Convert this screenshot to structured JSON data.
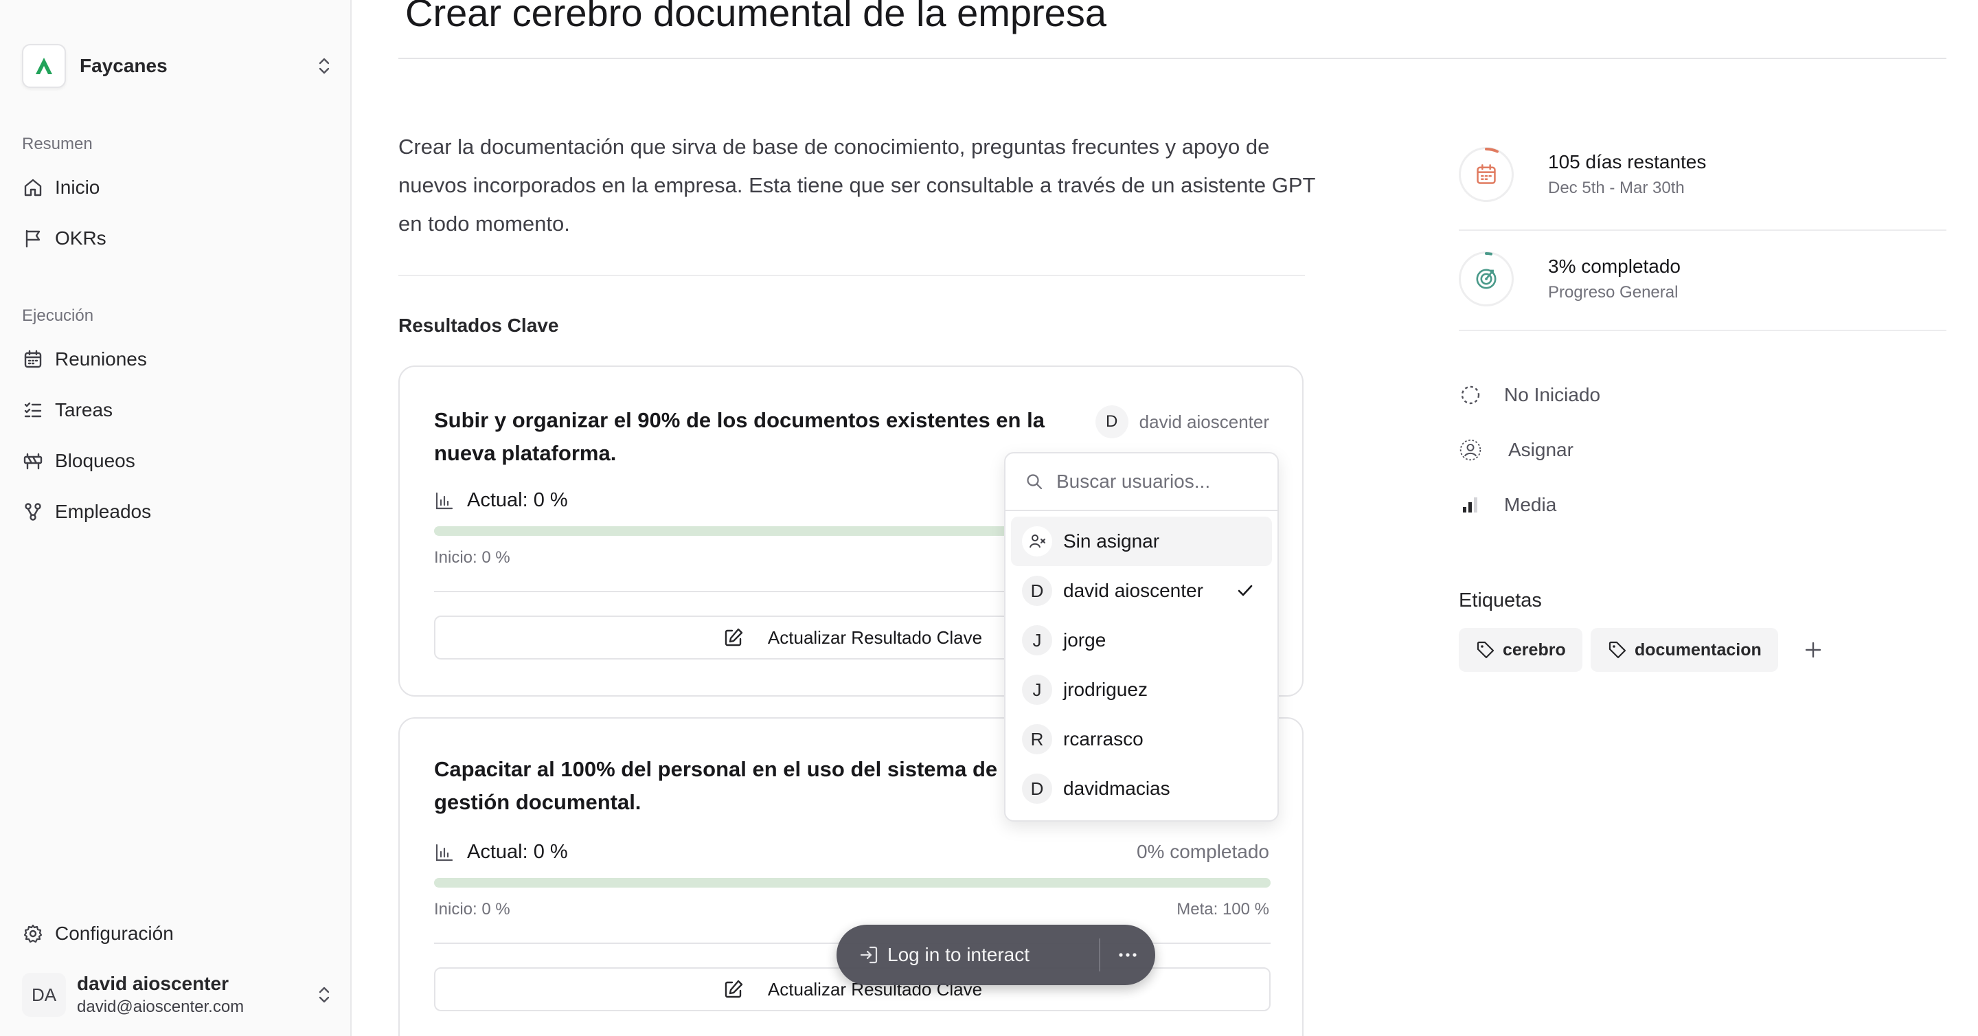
{
  "sidebar": {
    "org_name": "Faycanes",
    "sections": [
      {
        "label": "Resumen"
      },
      {
        "label": "Ejecución"
      }
    ],
    "items": [
      {
        "label": "Inicio",
        "icon": "home-icon"
      },
      {
        "label": "OKRs",
        "icon": "flag-icon"
      },
      {
        "label": "Reuniones",
        "icon": "calendar-icon"
      },
      {
        "label": "Tareas",
        "icon": "list-check-icon"
      },
      {
        "label": "Bloqueos",
        "icon": "roadblock-icon"
      },
      {
        "label": "Empleados",
        "icon": "org-chart-icon"
      }
    ],
    "settings_label": "Configuración",
    "user": {
      "initials": "DA",
      "name": "david aioscenter",
      "email": "david@aioscenter.com"
    }
  },
  "main": {
    "title": "Crear cerebro documental de la empresa",
    "description": "Crear la documentación que sirva de base de conocimiento, preguntas frecuntes y apoyo de nuevos incorporados en la empresa. Esta tiene que ser consultable a través de un asistente GPT en todo momento.",
    "key_results_heading": "Resultados Clave",
    "key_results": [
      {
        "title": "Subir y organizar el 90% de los documentos existentes en la nueva plataforma.",
        "assignee_initial": "D",
        "assignee": "david aioscenter",
        "actual": "Actual: 0 %",
        "progress": 0.0,
        "start": "Inicio: 0 %",
        "update_label": "Actualizar Resultado Clave"
      },
      {
        "title": "Capacitar al 100% del personal en el uso del sistema de gestión documental.",
        "actual": "Actual: 0 %",
        "completed": "0% completado",
        "progress": 0.0,
        "start": "Inicio: 0 %",
        "goal": "Meta: 100 %",
        "update_label": "Actualizar Resultado Clave"
      }
    ]
  },
  "details": {
    "days_remaining": "105 días restantes",
    "date_range": "Dec 5th - Mar 30th",
    "completion": "3% completado",
    "completion_sub": "Progreso General",
    "completion_value": 0.03,
    "status": "No Iniciado",
    "assign_label": "Asignar",
    "priority": "Media",
    "labels_heading": "Etiquetas",
    "tags": [
      "cerebro",
      "documentacion"
    ]
  },
  "dropdown": {
    "search_placeholder": "Buscar usuarios...",
    "options": [
      {
        "initial": "",
        "label": "Sin asignar",
        "selected_bg": true
      },
      {
        "initial": "D",
        "label": "david aioscenter",
        "checked": true
      },
      {
        "initial": "J",
        "label": "jorge"
      },
      {
        "initial": "J",
        "label": "jrodriguez"
      },
      {
        "initial": "R",
        "label": "rcarrasco"
      },
      {
        "initial": "D",
        "label": "davidmacias"
      }
    ]
  },
  "overlay": {
    "login_label": "Log in to interact"
  },
  "colors": {
    "accent_green": "#16a34a",
    "calendar_orange": "#e07a5f",
    "target_teal": "#4a9a8a"
  }
}
